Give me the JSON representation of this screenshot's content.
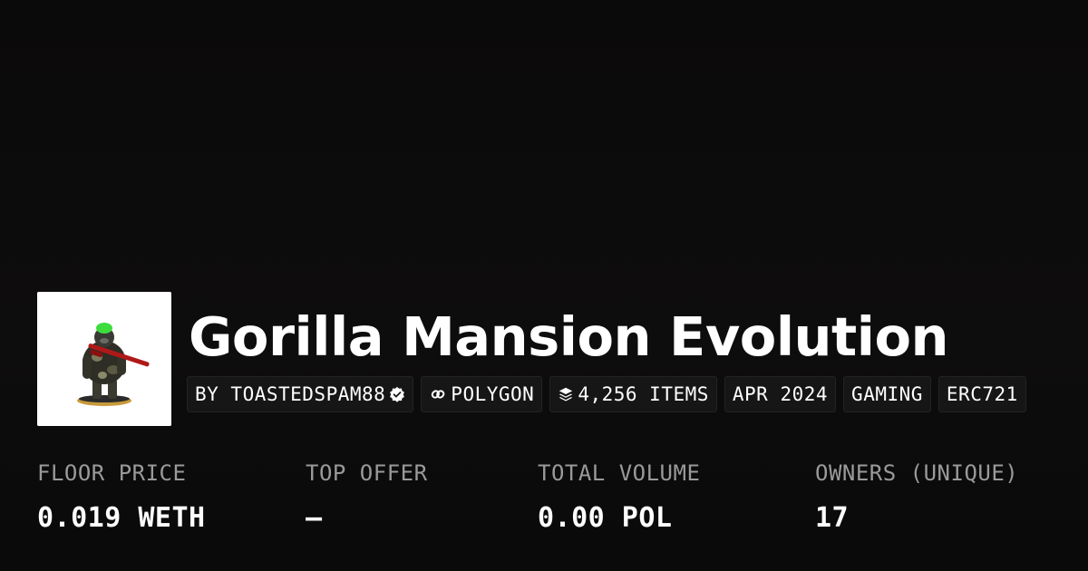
{
  "collection": {
    "title": "Gorilla Mansion Evolution",
    "avatar_icon": "gorilla-figurine-image"
  },
  "tags": [
    {
      "label": "BY TOASTEDSPAM88",
      "icon": "verified-badge-icon"
    },
    {
      "label": "POLYGON",
      "icon": "polygon-chain-icon"
    },
    {
      "label": "4,256 ITEMS",
      "icon": "layers-icon"
    },
    {
      "label": "APR 2024"
    },
    {
      "label": "GAMING"
    },
    {
      "label": "ERC721"
    }
  ],
  "stats": [
    {
      "label": "FLOOR PRICE",
      "value": "0.019 WETH"
    },
    {
      "label": "TOP OFFER",
      "value": "—"
    },
    {
      "label": "TOTAL VOLUME",
      "value": "0.00 POL"
    },
    {
      "label": "OWNERS (UNIQUE)",
      "value": "17"
    }
  ],
  "colors": {
    "background": "#0d0c0c",
    "tag_background": "#161616",
    "label_gray": "#9a9a9a",
    "text": "#ffffff"
  }
}
